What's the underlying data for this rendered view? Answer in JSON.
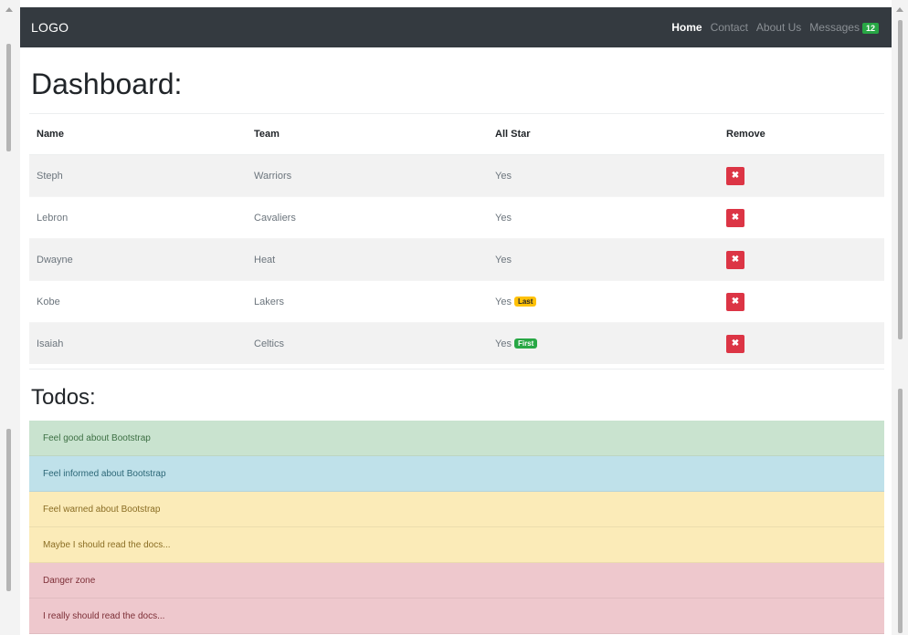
{
  "navbar": {
    "brand": "LOGO",
    "links": [
      {
        "label": "Home"
      },
      {
        "label": "Contact"
      },
      {
        "label": "About Us"
      },
      {
        "label": "Messages",
        "badge": "12"
      }
    ]
  },
  "dashboard": {
    "title": "Dashboard:",
    "columns": [
      "Name",
      "Team",
      "All Star",
      "Remove"
    ],
    "rows": [
      {
        "name": "Steph",
        "team": "Warriors",
        "allstar": "Yes",
        "label": ""
      },
      {
        "name": "Lebron",
        "team": "Cavaliers",
        "allstar": "Yes",
        "label": ""
      },
      {
        "name": "Dwayne",
        "team": "Heat",
        "allstar": "Yes",
        "label": ""
      },
      {
        "name": "Kobe",
        "team": "Lakers",
        "allstar": "Yes",
        "label": "Last"
      },
      {
        "name": "Isaiah",
        "team": "Celtics",
        "allstar": "Yes",
        "label": "First"
      }
    ],
    "remove_icon": "close-icon",
    "remove_symbol": "✖"
  },
  "todos": {
    "title": "Todos:",
    "items": [
      {
        "text": "Feel good about Bootstrap",
        "status": "success"
      },
      {
        "text": "Feel informed about Bootstrap",
        "status": "info"
      },
      {
        "text": "Feel warned about Bootstrap",
        "status": "warning"
      },
      {
        "text": "Maybe I should read the docs...",
        "status": "warning"
      },
      {
        "text": "Danger zone",
        "status": "danger"
      },
      {
        "text": "I really should read the docs...",
        "status": "danger"
      }
    ]
  },
  "colors": {
    "navbar_bg": "#343a40",
    "danger": "#dc3545",
    "success": "#28a745",
    "warning": "#ffc107"
  }
}
